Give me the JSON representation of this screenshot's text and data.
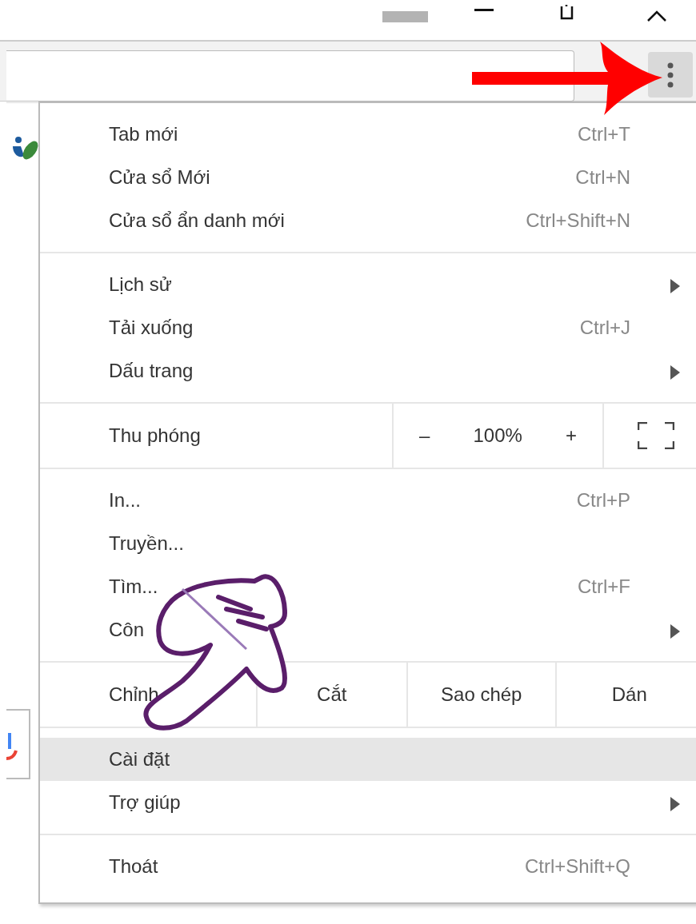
{
  "toolbar": {
    "menu_open": true
  },
  "menu": {
    "sections": [
      {
        "items": [
          {
            "kind": "item",
            "label": "Tab mới",
            "shortcut": "Ctrl+T",
            "submenu": false,
            "selected": false
          },
          {
            "kind": "item",
            "label": "Cửa sổ Mới",
            "shortcut": "Ctrl+N",
            "submenu": false,
            "selected": false
          },
          {
            "kind": "item",
            "label": "Cửa sổ ẩn danh mới",
            "shortcut": "Ctrl+Shift+N",
            "submenu": false,
            "selected": false
          }
        ]
      },
      {
        "items": [
          {
            "kind": "item",
            "label": "Lịch sử",
            "submenu": true,
            "selected": false
          },
          {
            "kind": "item",
            "label": "Tải xuống",
            "shortcut": "Ctrl+J",
            "submenu": false,
            "selected": false
          },
          {
            "kind": "item",
            "label": "Dấu trang",
            "submenu": true,
            "selected": false
          }
        ]
      },
      {
        "items": [
          {
            "kind": "zoom",
            "label": "Thu phóng",
            "minus": "–",
            "value": "100%",
            "plus": "+"
          }
        ]
      },
      {
        "items": [
          {
            "kind": "item",
            "label": "In...",
            "shortcut": "Ctrl+P",
            "submenu": false,
            "selected": false
          },
          {
            "kind": "item",
            "label": "Truyền...",
            "submenu": false,
            "selected": false
          },
          {
            "kind": "item",
            "label": "Tìm...",
            "shortcut": "Ctrl+F",
            "submenu": false,
            "selected": false
          },
          {
            "kind": "item",
            "label": "Côn",
            "submenu": true,
            "selected": false
          }
        ]
      },
      {
        "items": [
          {
            "kind": "edit",
            "label": "Chỉnh",
            "buttons": [
              "Cắt",
              "Sao chép",
              "Dán"
            ]
          }
        ]
      },
      {
        "items": [
          {
            "kind": "item",
            "label": "Cài đặt",
            "submenu": false,
            "selected": true
          },
          {
            "kind": "item",
            "label": "Trợ giúp",
            "submenu": true,
            "selected": false
          }
        ]
      },
      {
        "items": [
          {
            "kind": "item",
            "label": "Thoát",
            "shortcut": "Ctrl+Shift+Q",
            "submenu": false,
            "selected": false
          }
        ]
      }
    ]
  }
}
